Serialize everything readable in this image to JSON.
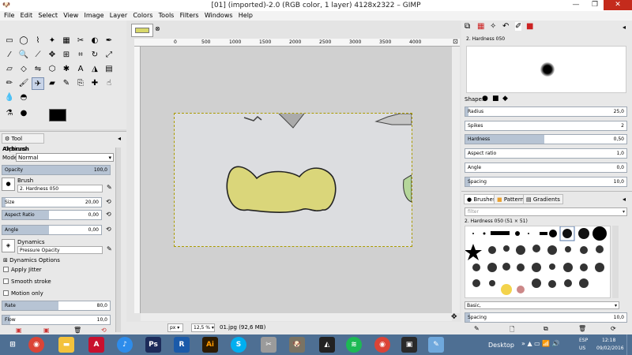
{
  "window": {
    "title": "[01] (imported)-2.0 (RGB color, 1 layer) 4128x2322 – GIMP"
  },
  "menu": [
    "File",
    "Edit",
    "Select",
    "View",
    "Image",
    "Layer",
    "Colors",
    "Tools",
    "Filters",
    "Windows",
    "Help"
  ],
  "tool_options": {
    "tab_label": "Tool Options",
    "tool_name": "Airbrush",
    "mode_label": "Mode:",
    "mode_value": "Normal",
    "opacity": {
      "label": "Opacity",
      "value": "100,0",
      "fraction": 1.0
    },
    "brush_label": "Brush",
    "brush_value": "2. Hardness 050",
    "size": {
      "label": "Size",
      "value": "20,00",
      "fraction": 0.03
    },
    "aspect": {
      "label": "Aspect Ratio",
      "value": "0,00",
      "fraction": 0.5
    },
    "angle": {
      "label": "Angle",
      "value": "0,00",
      "fraction": 0.5
    },
    "dynamics_label": "Dynamics",
    "dynamics_value": "Pressure Opacity",
    "dynamics_options": "Dynamics Options",
    "apply_jitter": "Apply Jitter",
    "smooth_stroke": "Smooth stroke",
    "motion_only": "Motion only",
    "rate": {
      "label": "Rate",
      "value": "80,0",
      "fraction": 0.5
    },
    "flow": {
      "label": "Flow",
      "value": "10,0",
      "fraction": 0.07
    }
  },
  "ruler": {
    "labels": [
      "0",
      "500",
      "1000",
      "1500",
      "2000",
      "2500",
      "3000",
      "3500",
      "4000"
    ]
  },
  "status": {
    "unit": "px",
    "zoom": "12,5 %",
    "file": "01.jpg (92,6 MB)"
  },
  "brush_editor": {
    "name": "2. Hardness 050",
    "shape_label": "Shape:",
    "params": [
      {
        "label": "Radius",
        "value": "25,0",
        "fraction": 0.03
      },
      {
        "label": "Spikes",
        "value": "2",
        "fraction": 0.0
      },
      {
        "label": "Hardness",
        "value": "0,50",
        "fraction": 0.5
      },
      {
        "label": "Aspect ratio",
        "value": "1,0",
        "fraction": 0.0
      },
      {
        "label": "Angle",
        "value": "0,0",
        "fraction": 0.0
      },
      {
        "label": "Spacing",
        "value": "10,0",
        "fraction": 0.05
      }
    ]
  },
  "brushes": {
    "tabs": [
      "Brushes",
      "Patterns",
      "Gradients"
    ],
    "filter_placeholder": "filter",
    "selected": "2. Hardness 050 (51 × 51)",
    "tag": "Basic,",
    "spacing": {
      "label": "Spacing",
      "value": "10,0",
      "fraction": 0.05
    }
  },
  "taskbar": {
    "apps": [
      "chrome",
      "file-explorer",
      "autocad",
      "itunes",
      "photoshop",
      "revit",
      "illustrator",
      "skype",
      "snipping-tool",
      "gimp",
      "inkscape",
      "spotify",
      "chrome-2",
      "reader",
      "paint"
    ],
    "desktop_label": "Desktop",
    "lang": "ESP",
    "region": "US",
    "time": "12:18",
    "date": "09/02/2016"
  }
}
